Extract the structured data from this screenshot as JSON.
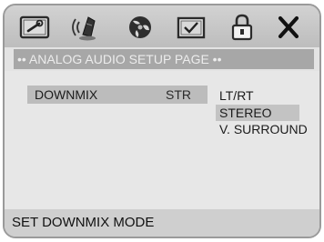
{
  "toolbar": {
    "icons": [
      "general-setup-icon",
      "audio-speaker-icon",
      "video-disc-icon",
      "preference-check-icon",
      "lock-icon",
      "exit-icon"
    ]
  },
  "page_title": "•• ANALOG AUDIO SETUP PAGE ••",
  "setting": {
    "label": "DOWNMIX",
    "current_value": "STR"
  },
  "options": [
    {
      "label": "LT/RT",
      "selected": false
    },
    {
      "label": "STEREO",
      "selected": true
    },
    {
      "label": "V. SURROUND",
      "selected": false
    }
  ],
  "status": "SET DOWNMIX MODE",
  "colors": {
    "frame_border": "#9a9a9a",
    "banner_bg": "#a7a7a7",
    "highlight_bg": "#bcbcbc"
  }
}
